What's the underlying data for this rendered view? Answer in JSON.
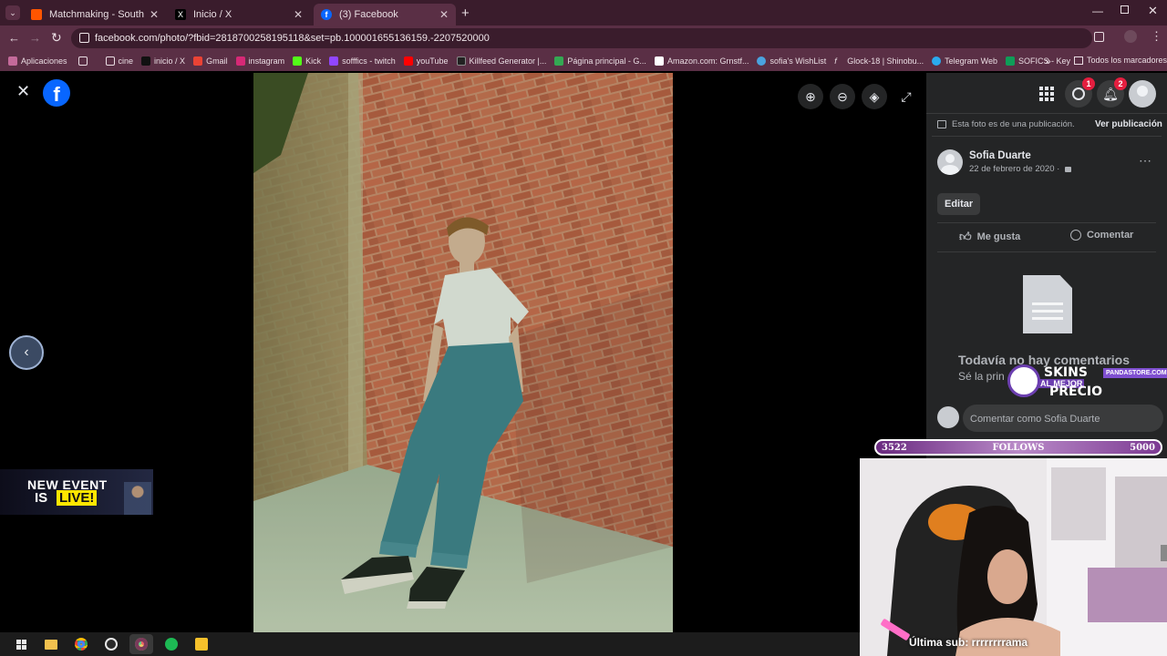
{
  "browser": {
    "tabs": [
      {
        "title": "Matchmaking - South America",
        "active": false
      },
      {
        "title": "Inicio / X",
        "active": false
      },
      {
        "title": "(3) Facebook",
        "active": true
      }
    ],
    "new_tab_symbol": "+",
    "url": "facebook.com/photo/?fbid=2818700258195118&set=pb.100001655136159.-2207520000",
    "bookmarks": [
      "Aplicaciones",
      "cine",
      "inicio / X",
      "Gmail",
      "instagram",
      "Kick",
      "sofffics - twitch",
      "youTube",
      "Killfeed Generator |...",
      "Página principal - G...",
      "Amazon.com: Grnstf...",
      "sofia's WishList",
      "Glock-18 | Shinobu...",
      "Telegram Web",
      "SOFICS - Key"
    ],
    "bookmarks_more": "»",
    "all_bookmarks": "Todos los marcadores"
  },
  "header": {
    "messenger_badge": "1",
    "notifications_badge": "2"
  },
  "post": {
    "notice": "Esta foto es de una publicación.",
    "view_post": "Ver publicación",
    "author": "Sofia Duarte",
    "date": "22 de febrero de 2020 ·",
    "edit": "Editar",
    "like": "Me gusta",
    "comment": "Comentar",
    "no_comments_title": "Todavía no hay comentarios",
    "no_comments_sub": "Sé la prin",
    "comment_placeholder": "Comentar como Sofia Duarte"
  },
  "overlays": {
    "event_line1": "NEW EVENT",
    "event_is": "IS",
    "event_live": "LIVE!",
    "skins_line1": "SKINS",
    "skins_line2": "AL MEJOR",
    "skins_line3": "PRECIO",
    "skins_site": "PANDASTORE.COM",
    "follows_current": "3522",
    "follows_label": "FOLLOWS",
    "follows_goal": "5000",
    "follows_progress": 0.7044,
    "last_sub": "Última sub: rrrrrrrrama"
  },
  "colors": {
    "facebook_blue": "#0866ff",
    "panel_bg": "#242526",
    "tab_bg": "#3a1c2c",
    "toolbar_bg": "#5a2f45",
    "badge_red": "#e41e3f"
  }
}
